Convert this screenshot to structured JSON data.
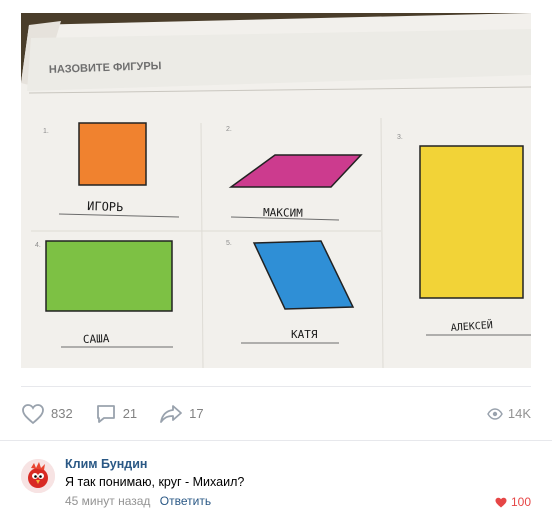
{
  "photo": {
    "header": "НАЗОВИТЕ ФИГУРЫ",
    "figures": [
      {
        "number": "1.",
        "name": "ИГОРЬ",
        "color": "#f0822f"
      },
      {
        "number": "2.",
        "name": "МАКСИМ",
        "color": "#cc3b8e"
      },
      {
        "number": "3.",
        "name": "АЛЕКСЕЙ",
        "color": "#f2d337"
      },
      {
        "number": "4.",
        "name": "САША",
        "color": "#7dc144"
      },
      {
        "number": "5.",
        "name": "КАТЯ",
        "color": "#2f8fd6"
      }
    ]
  },
  "actions": {
    "likes": "832",
    "comments": "21",
    "shares": "17",
    "views": "14K",
    "icons": [
      "heart-icon",
      "comment-icon",
      "share-icon",
      "eye-icon"
    ]
  },
  "comment": {
    "author": "Клим Бундин",
    "text": "Я так понимаю, круг - Михаил?",
    "time": "45 минут назад",
    "reply_label": "Ответить",
    "likes": "100"
  },
  "colors": {
    "link": "#2a5885",
    "muted": "#828282",
    "like_red": "#e64646"
  }
}
